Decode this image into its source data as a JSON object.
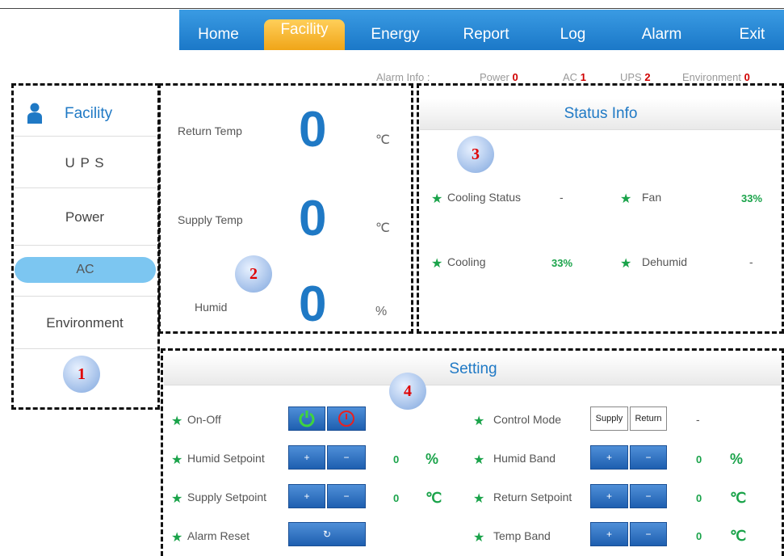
{
  "nav": {
    "home": "Home",
    "facility": "Facility",
    "energy": "Energy",
    "report": "Report",
    "log": "Log",
    "alarm": "Alarm",
    "exit": "Exit",
    "active_color": "#f5b021",
    "bar_color": "#2a8ad6"
  },
  "alarm_info": {
    "label": "Alarm Info :",
    "power_label": "Power",
    "power_value": "0",
    "ac_label": "AC",
    "ac_value": "1",
    "ups_label": "UPS",
    "ups_value": "2",
    "env_label": "Environment",
    "env_value": "0"
  },
  "sidebar": {
    "title": "Facility",
    "items": [
      "U P S",
      "Power",
      "AC",
      "Environment"
    ],
    "selected": "AC",
    "icon": "person-icon"
  },
  "readings": {
    "return_label": "Return Temp",
    "return_value": "0",
    "return_unit": "℃",
    "supply_label": "Supply Temp",
    "supply_value": "0",
    "supply_unit": "℃",
    "humid_label": "Humid",
    "humid_value": "0",
    "humid_unit": "%"
  },
  "status": {
    "title": "Status Info",
    "cooling_status_label": "Cooling Status",
    "cooling_status_value": "-",
    "fan_label": "Fan",
    "fan_value": "33%",
    "cooling_label": "Cooling",
    "cooling_value": "33%",
    "dehumid_label": "Dehumid",
    "dehumid_value": "-"
  },
  "setting": {
    "title": "Setting",
    "onoff_label": "On-Off",
    "humid_setpoint_label": "Humid Setpoint",
    "humid_setpoint_value": "0",
    "humid_setpoint_unit": "%",
    "supply_setpoint_label": "Supply Setpoint",
    "supply_setpoint_value": "0",
    "supply_setpoint_unit": "℃",
    "alarm_reset_label": "Alarm Reset",
    "control_mode_label": "Control Mode",
    "control_mode_supply": "Supply",
    "control_mode_return": "Return",
    "control_mode_value": "-",
    "humid_band_label": "Humid Band",
    "humid_band_value": "0",
    "humid_band_unit": "%",
    "return_setpoint_label": "Return Setpoint",
    "return_setpoint_value": "0",
    "return_setpoint_unit": "℃",
    "temp_band_label": "Temp Band",
    "temp_band_value": "0",
    "temp_band_unit": "℃",
    "plus": "+",
    "minus": "−",
    "reset_glyph": "↻"
  },
  "badges": [
    "1",
    "2",
    "3",
    "4"
  ]
}
